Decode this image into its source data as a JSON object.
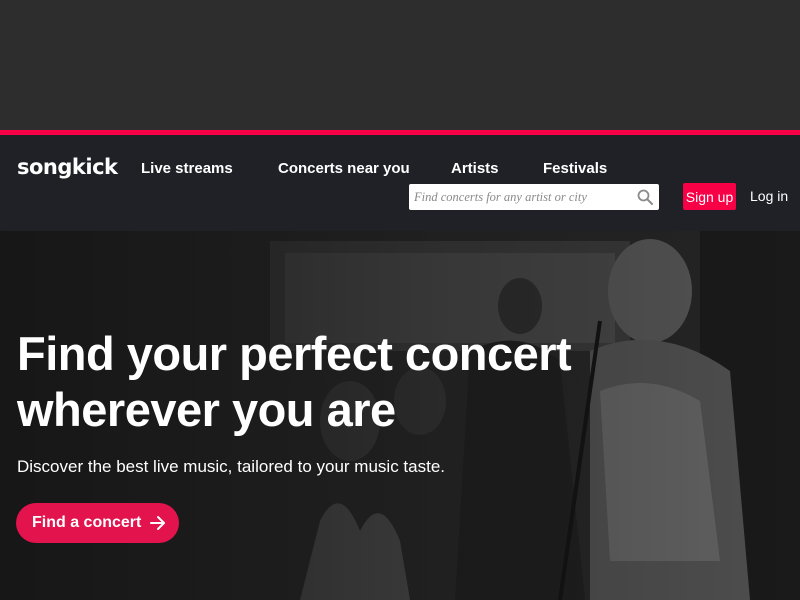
{
  "header": {
    "logo_text": "songkick",
    "nav": [
      {
        "label": "Live streams"
      },
      {
        "label": "Concerts near you"
      },
      {
        "label": "Artists"
      },
      {
        "label": "Festivals"
      }
    ],
    "search": {
      "placeholder": "Find concerts for any artist or city",
      "icon": "search-icon"
    },
    "signup_label": "Sign up",
    "login_label": "Log in"
  },
  "hero": {
    "title_line1": "Find your perfect concert",
    "title_line2": "wherever you are",
    "subtitle": "Discover the best live music, tailored to your music taste.",
    "cta_label": "Find a concert",
    "cta_icon": "arrow-right-icon"
  },
  "colors": {
    "accent": "#f80046",
    "cta": "#e2134d",
    "navbar_bg": "#1f2126",
    "top_bg": "#2d2d2d"
  }
}
